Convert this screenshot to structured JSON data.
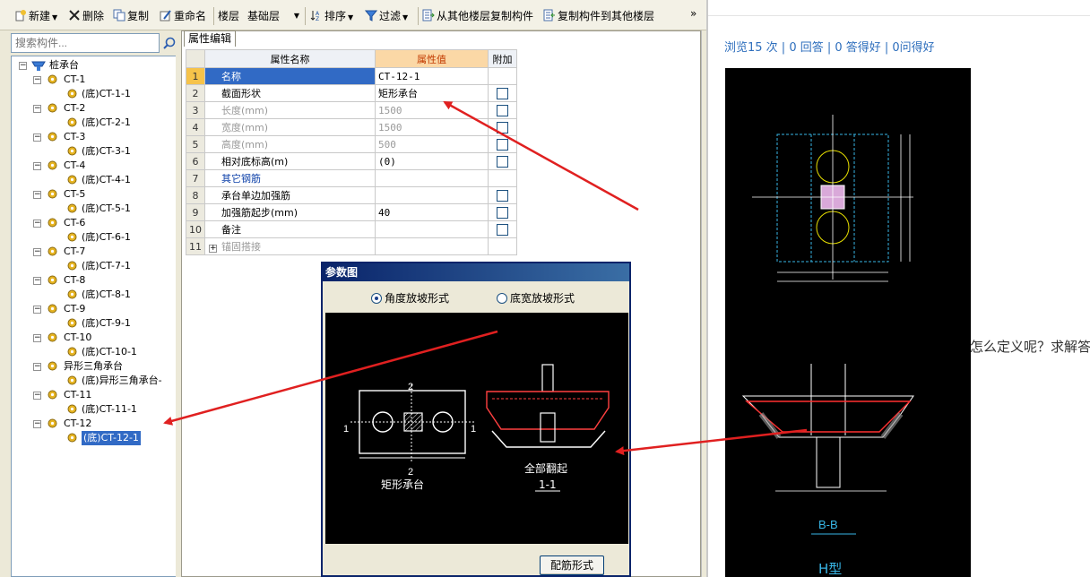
{
  "toolbar": {
    "new_label": "新建",
    "delete_label": "删除",
    "copy_label": "复制",
    "rename_label": "重命名",
    "floor_label": "楼层",
    "floor_value": "基础层",
    "sort_label": "排序",
    "filter_label": "过滤",
    "copy_from_floor_label": "从其他楼层复制构件",
    "copy_to_floor_label": "复制构件到其他楼层",
    "more_label": "»"
  },
  "search": {
    "placeholder": "搜索构件..."
  },
  "tree": {
    "root": "桩承台",
    "groups": [
      {
        "name": "CT-1",
        "child": "(底)CT-1-1"
      },
      {
        "name": "CT-2",
        "child": "(底)CT-2-1"
      },
      {
        "name": "CT-3",
        "child": "(底)CT-3-1"
      },
      {
        "name": "CT-4",
        "child": "(底)CT-4-1"
      },
      {
        "name": "CT-5",
        "child": "(底)CT-5-1"
      },
      {
        "name": "CT-6",
        "child": "(底)CT-6-1"
      },
      {
        "name": "CT-7",
        "child": "(底)CT-7-1"
      },
      {
        "name": "CT-8",
        "child": "(底)CT-8-1"
      },
      {
        "name": "CT-9",
        "child": "(底)CT-9-1"
      },
      {
        "name": "CT-10",
        "child": "(底)CT-10-1"
      },
      {
        "name": "异形三角承台",
        "child": "(底)异形三角承台-"
      },
      {
        "name": "CT-11",
        "child": "(底)CT-11-1"
      },
      {
        "name": "CT-12",
        "child": "(底)CT-12-1"
      }
    ],
    "selected": "(底)CT-12-1"
  },
  "properties": {
    "tab": "属性编辑",
    "headers": [
      "属性名称",
      "属性值",
      "附加"
    ],
    "rows": [
      {
        "num": "1",
        "name": "名称",
        "value": "CT-12-1",
        "check": false,
        "style": "current"
      },
      {
        "num": "2",
        "name": "截面形状",
        "value": "矩形承台",
        "check": true,
        "style": "normal"
      },
      {
        "num": "3",
        "name": "长度(mm)",
        "value": "1500",
        "check": true,
        "style": "gray"
      },
      {
        "num": "4",
        "name": "宽度(mm)",
        "value": "1500",
        "check": true,
        "style": "gray"
      },
      {
        "num": "5",
        "name": "高度(mm)",
        "value": "500",
        "check": true,
        "style": "gray"
      },
      {
        "num": "6",
        "name": "相对底标高(m)",
        "value": "(0)",
        "check": true,
        "style": "normal"
      },
      {
        "num": "7",
        "name": "其它钢筋",
        "value": "",
        "check": false,
        "style": "blue"
      },
      {
        "num": "8",
        "name": "承台单边加强筋",
        "value": "",
        "check": true,
        "style": "normal"
      },
      {
        "num": "9",
        "name": "加强筋起步(mm)",
        "value": "40",
        "check": true,
        "style": "normal"
      },
      {
        "num": "10",
        "name": "备注",
        "value": "",
        "check": true,
        "style": "normal"
      },
      {
        "num": "11",
        "name": "锚固搭接",
        "value": "",
        "check": false,
        "style": "gray",
        "expandable": true
      }
    ]
  },
  "dialog": {
    "title": "参数图",
    "radio_angle": "角度放坡形式",
    "radio_width": "底宽放坡形式",
    "selected": "angle",
    "drawing": {
      "plan_label": "矩形承台",
      "section_label": "全部翻起",
      "section_mark": "1-1",
      "dim_top": "2",
      "dim_bottom": "2",
      "dim_left": "1",
      "dim_right": "1"
    },
    "button": "配筋形式"
  },
  "web": {
    "stats": "浏览15 次 | 0 回答 | 0 答得好 | 0问得好",
    "question": "怎么定义呢？求解答",
    "image_section_label": "B-B",
    "image_type_label": "H型"
  }
}
